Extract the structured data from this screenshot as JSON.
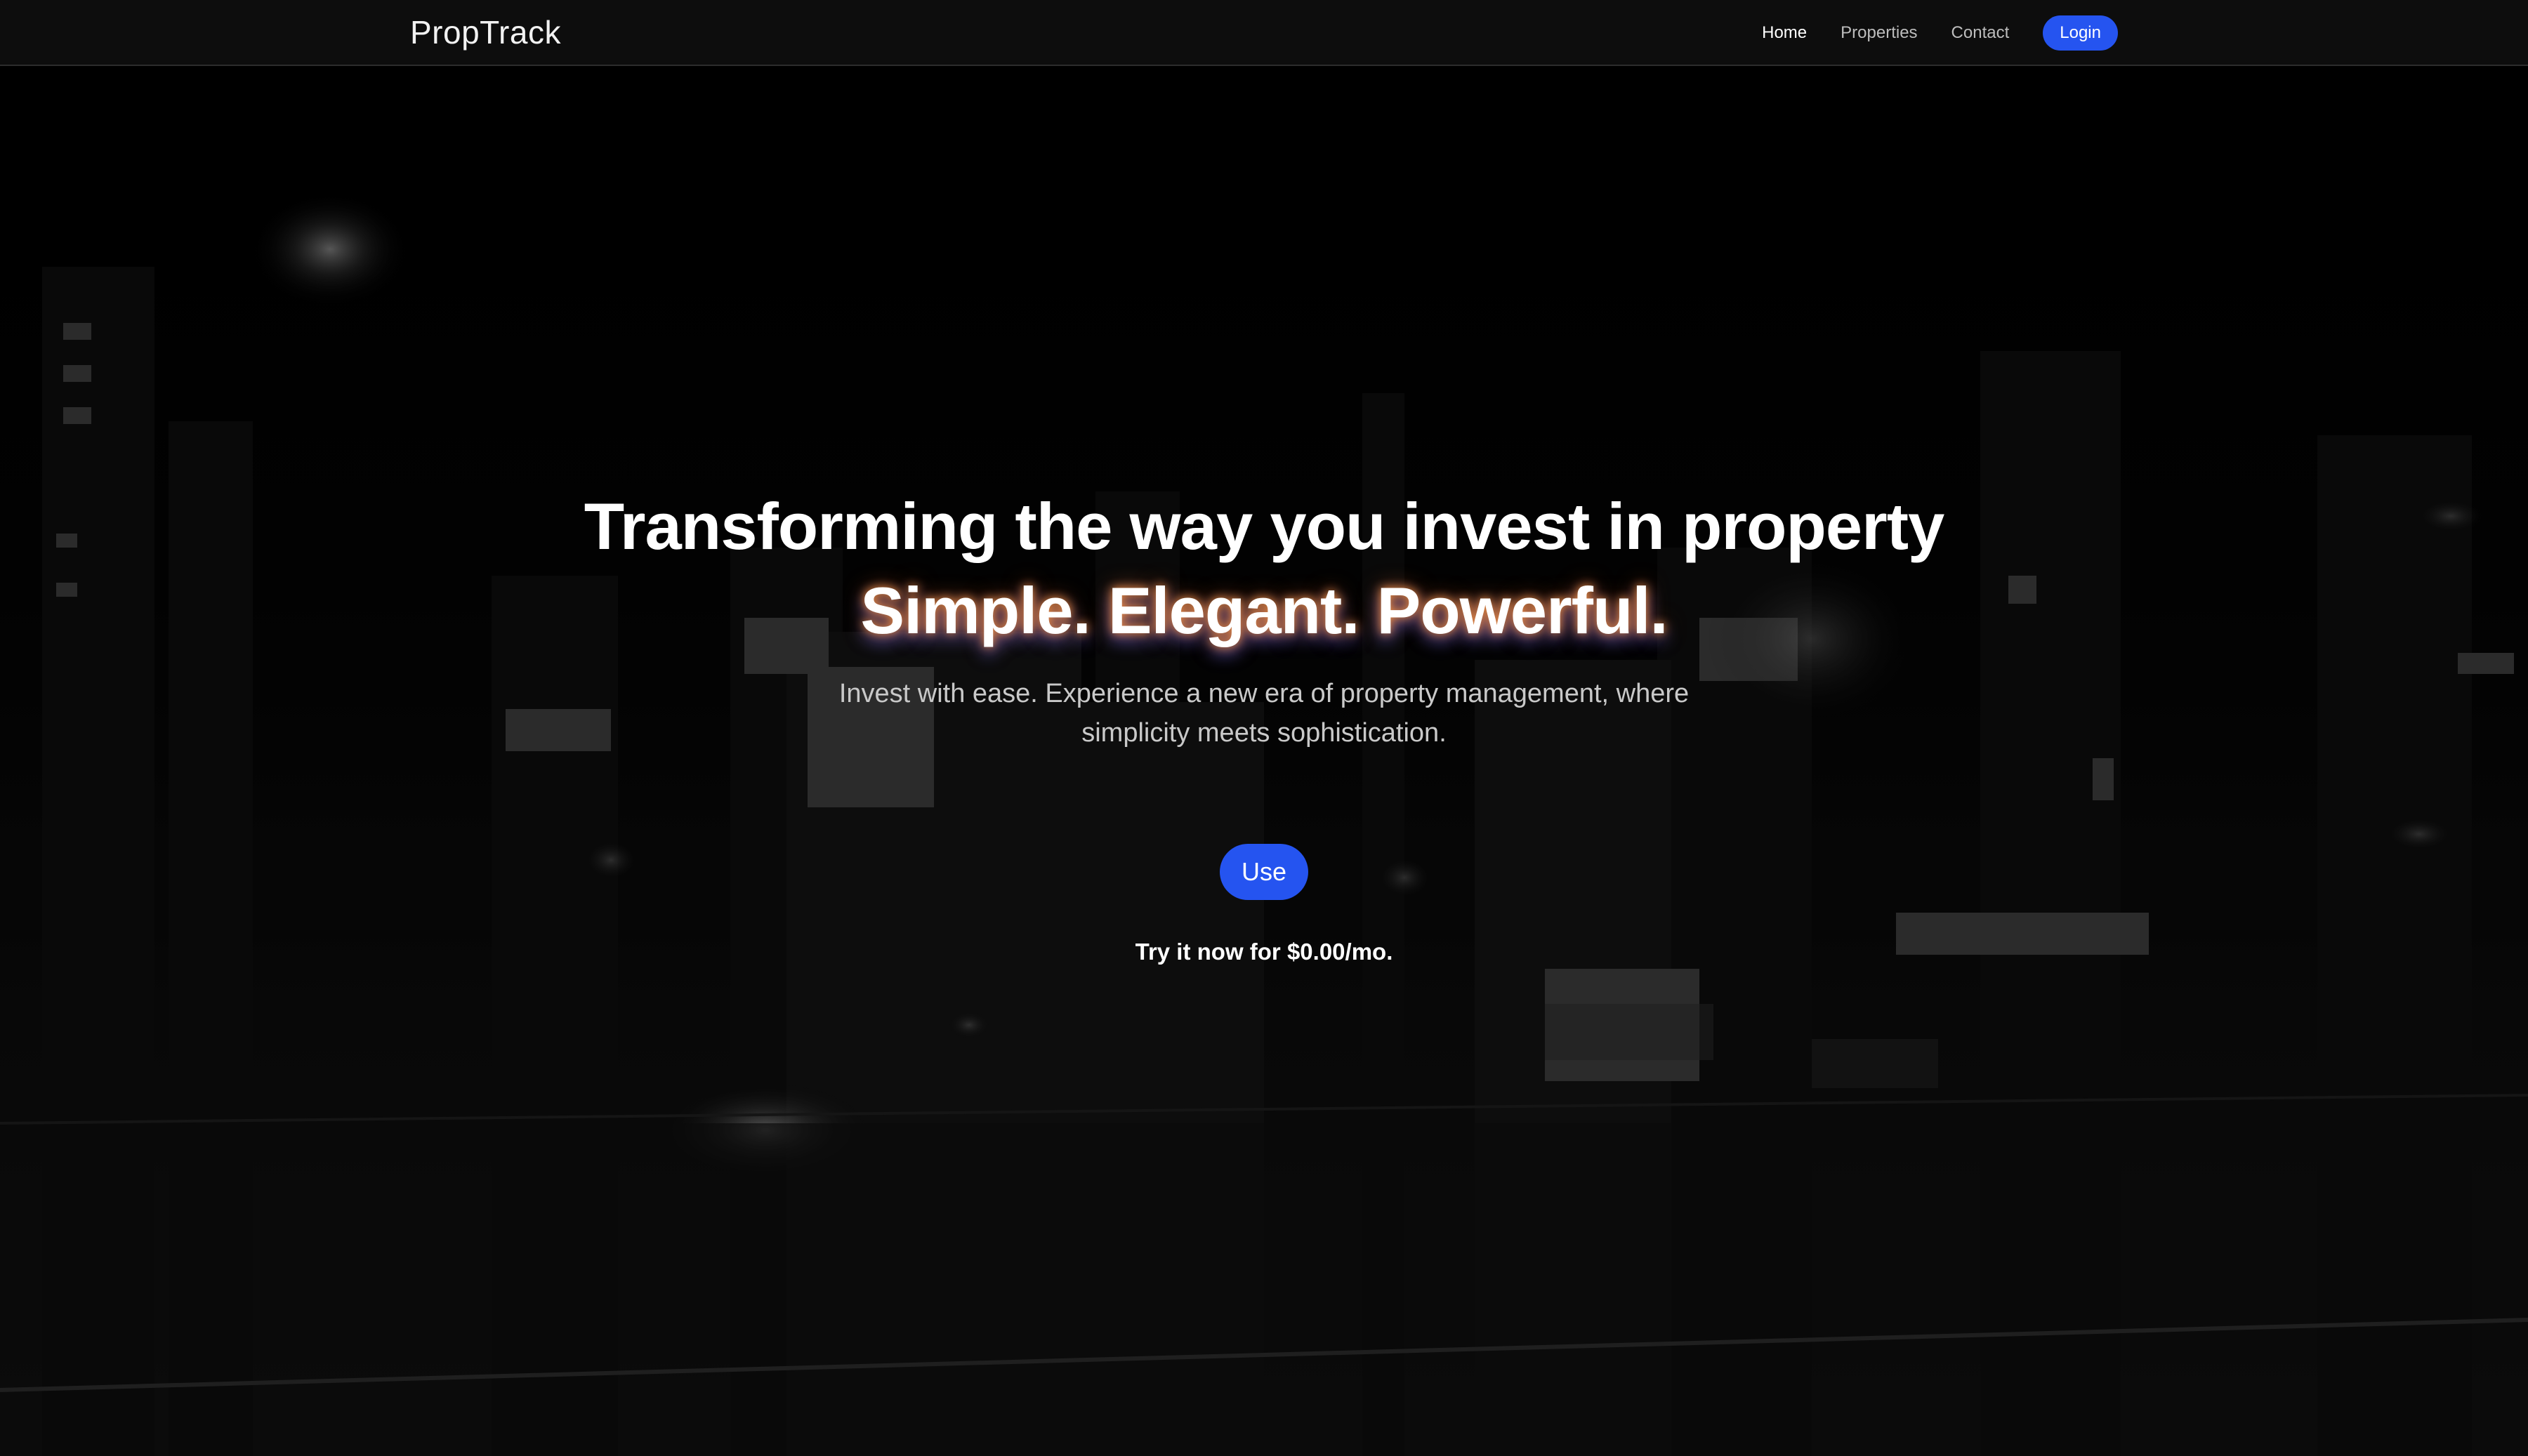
{
  "header": {
    "brand": "PropTrack",
    "nav": [
      {
        "label": "Home",
        "active": true
      },
      {
        "label": "Properties",
        "active": false
      },
      {
        "label": "Contact",
        "active": false
      }
    ],
    "login_label": "Login"
  },
  "hero": {
    "title": "Transforming the way you invest in property",
    "tagline": "Simple. Elegant. Powerful.",
    "description": "Invest with ease. Experience a new era of property management, where simplicity meets sophistication.",
    "cta_label": "Use",
    "cta_note": "Try it now for $0.00/mo."
  },
  "colors": {
    "accent": "#2554f0",
    "background": "#000000",
    "navbar": "#0d0d0d"
  },
  "icons": {
    "background": "night-city-photo"
  }
}
